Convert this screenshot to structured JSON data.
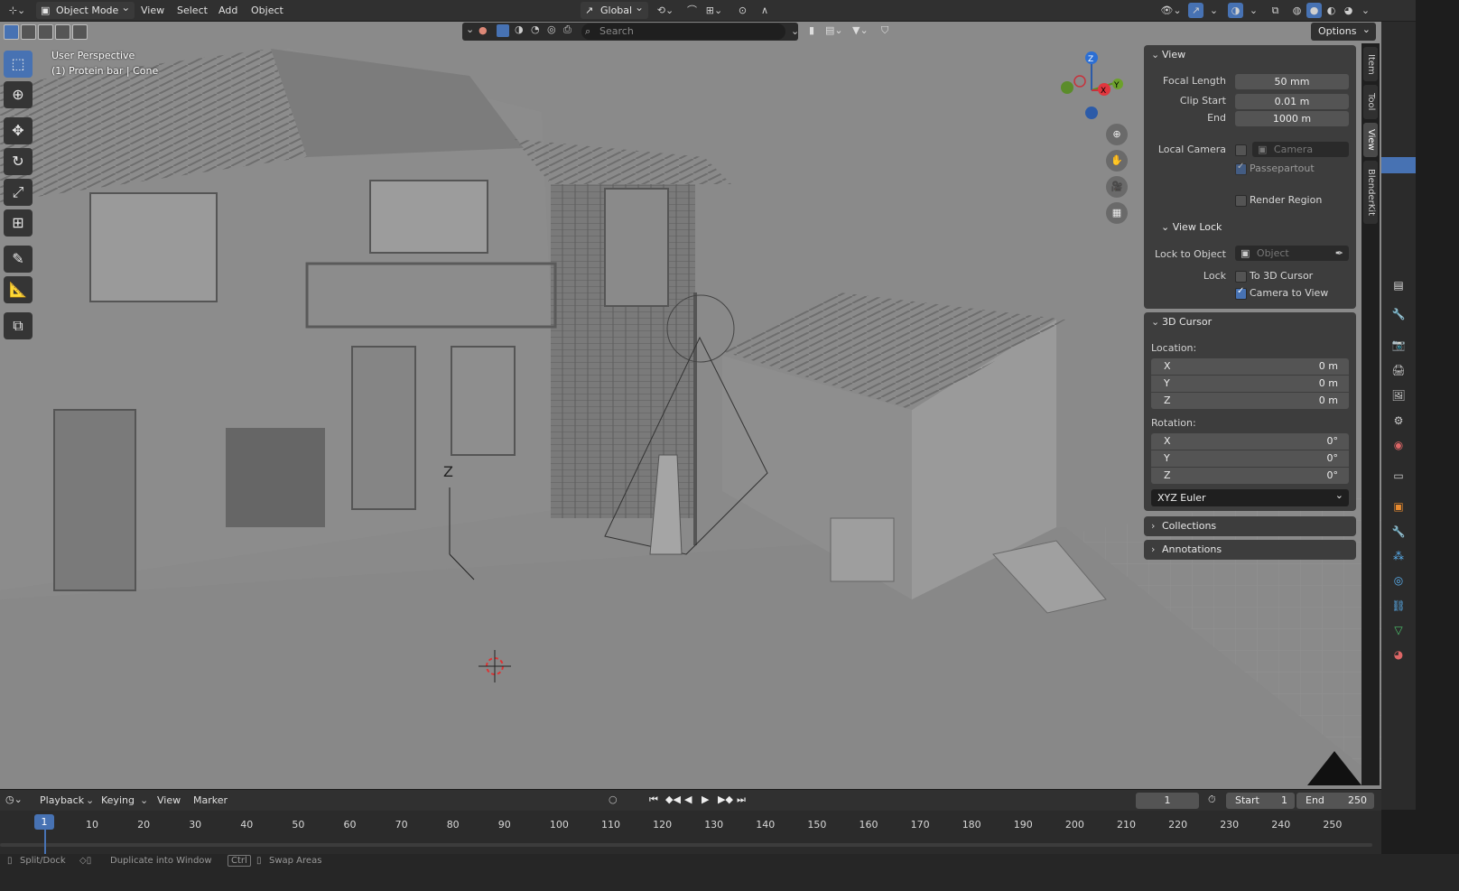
{
  "header": {
    "mode_label": "Object Mode",
    "menus": [
      "View",
      "Select",
      "Add",
      "Object"
    ],
    "transform_orientation": "Global"
  },
  "subheader": {
    "search_placeholder": "Search",
    "options_label": "Options"
  },
  "viewport": {
    "perspective_label": "User Perspective",
    "object_label": "(1) Protein bar | Cone",
    "gizmo_axes": {
      "x": "X",
      "y": "Y",
      "z": "Z"
    },
    "empty_label": "Z"
  },
  "npanel": {
    "view": {
      "title": "View",
      "focal_length_label": "Focal Length",
      "focal_length_value": "50 mm",
      "clip_start_label": "Clip Start",
      "clip_start_value": "0.01 m",
      "end_label": "End",
      "end_value": "1000 m",
      "local_camera_label": "Local Camera",
      "camera_placeholder": "Camera",
      "passepartout_label": "Passepartout",
      "render_region_label": "Render Region",
      "view_lock_title": "View Lock",
      "lock_to_object_label": "Lock to Object",
      "object_placeholder": "Object",
      "lock_label": "Lock",
      "to_3d_cursor_label": "To 3D Cursor",
      "camera_to_view_label": "Camera to View"
    },
    "cursor": {
      "title": "3D Cursor",
      "location_label": "Location:",
      "location": [
        {
          "axis": "X",
          "value": "0 m"
        },
        {
          "axis": "Y",
          "value": "0 m"
        },
        {
          "axis": "Z",
          "value": "0 m"
        }
      ],
      "rotation_label": "Rotation:",
      "rotation": [
        {
          "axis": "X",
          "value": "0°"
        },
        {
          "axis": "Y",
          "value": "0°"
        },
        {
          "axis": "Z",
          "value": "0°"
        }
      ],
      "rotation_mode": "XYZ Euler"
    },
    "collections_title": "Collections",
    "annotations_title": "Annotations",
    "tabs": [
      "Item",
      "Tool",
      "View",
      "BlenderKit"
    ]
  },
  "timeline": {
    "menus": [
      "Playback",
      "Keying",
      "View",
      "Marker"
    ],
    "current_frame": "1",
    "start_label": "Start",
    "start_value": "1",
    "end_label": "End",
    "end_value": "250",
    "ruler": [
      "1",
      "10",
      "20",
      "30",
      "40",
      "50",
      "60",
      "70",
      "80",
      "90",
      "100",
      "110",
      "120",
      "130",
      "140",
      "150",
      "160",
      "170",
      "180",
      "190",
      "200",
      "210",
      "220",
      "230",
      "240",
      "250"
    ]
  },
  "status": {
    "items": [
      "Split/Dock",
      "Duplicate into Window",
      "Ctrl",
      "Swap Areas"
    ]
  }
}
